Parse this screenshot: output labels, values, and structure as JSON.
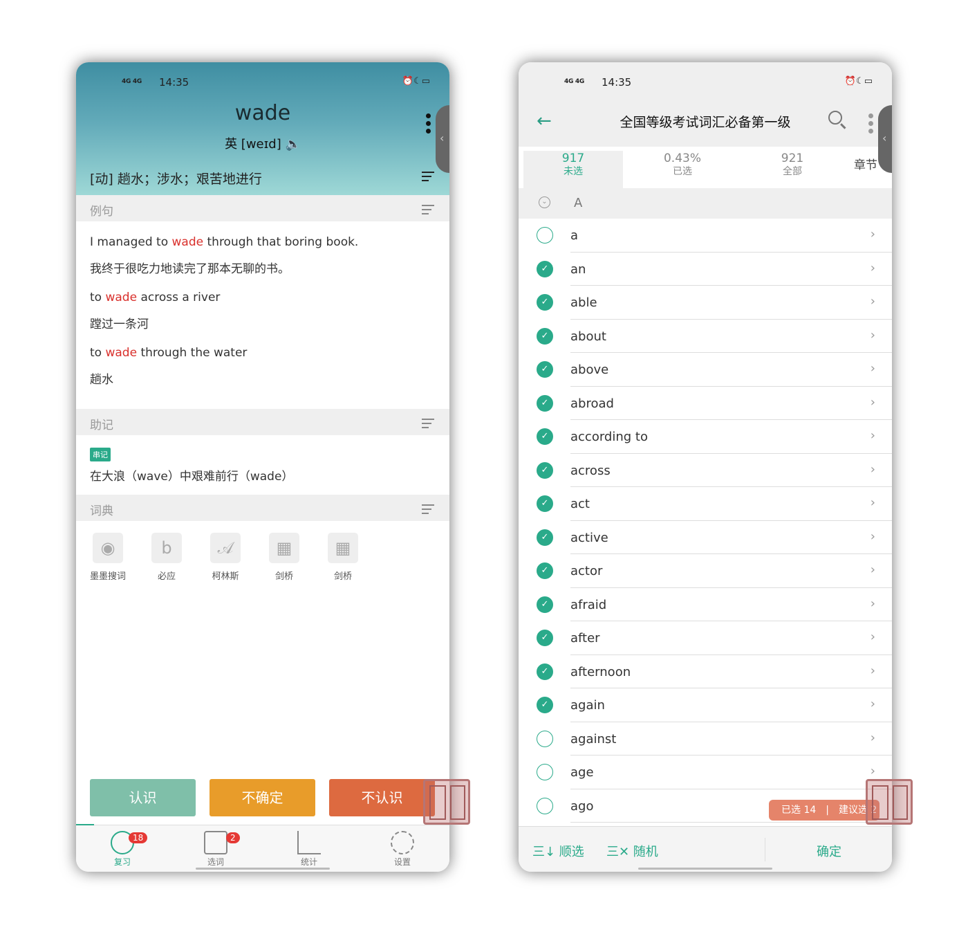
{
  "status": {
    "time": "14:35",
    "network": "4G 4G",
    "icons": "alarm moon battery"
  },
  "left": {
    "word": "wade",
    "phonetic": "英 [weɪd]",
    "speaker_icon": "🔈",
    "definition": "[动] 趟水；涉水；艰苦地进行",
    "sections": {
      "examples": "例句",
      "mnemonic": "助记",
      "dictionary": "词典"
    },
    "examples": [
      {
        "pre": "I managed to ",
        "hl": "wade",
        "post": " through that boring book.",
        "cn": "我终于很吃力地读完了那本无聊的书。"
      },
      {
        "pre": "to ",
        "hl": "wade",
        "post": " across a river",
        "cn": "蹚过一条河"
      },
      {
        "pre": "to ",
        "hl": "wade",
        "post": " through the water",
        "cn": "趟水"
      }
    ],
    "mnemonic_tag": "串记",
    "mnemonic_text": "在大浪（wave）中艰难前行（wade）",
    "dicts": [
      {
        "label": "墨墨搜词",
        "icon": "owl-icon"
      },
      {
        "label": "必应",
        "icon": "bing-icon"
      },
      {
        "label": "柯林斯",
        "icon": "collins-icon"
      },
      {
        "label": "剑桥",
        "icon": "cambridge-cn-icon"
      },
      {
        "label": "剑桥",
        "icon": "cambridge-en-icon"
      }
    ],
    "buttons": {
      "know": "认识",
      "unsure": "不确定",
      "unknown": "不认识"
    },
    "colors": {
      "know": "#7fbfa9",
      "unsure": "#e89c2a",
      "unknown": "#dd6a40",
      "accent": "#2aaa8a"
    },
    "nav": [
      {
        "label": "复习",
        "badge": "18"
      },
      {
        "label": "选词",
        "badge": "2"
      },
      {
        "label": "统计"
      },
      {
        "label": "设置"
      }
    ]
  },
  "right": {
    "title": "全国等级考试词汇必备第一级",
    "stats": [
      {
        "value": "917",
        "label": "未选"
      },
      {
        "value": "0.43%",
        "label": "已选"
      },
      {
        "value": "921",
        "label": "全部"
      }
    ],
    "chapter": "章节",
    "group": "A",
    "words": [
      {
        "w": "a",
        "checked": false
      },
      {
        "w": "an",
        "checked": true
      },
      {
        "w": "able",
        "checked": true
      },
      {
        "w": "about",
        "checked": true
      },
      {
        "w": "above",
        "checked": true
      },
      {
        "w": "abroad",
        "checked": true
      },
      {
        "w": "according to",
        "checked": true
      },
      {
        "w": "across",
        "checked": true
      },
      {
        "w": "act",
        "checked": true
      },
      {
        "w": "active",
        "checked": true
      },
      {
        "w": "actor",
        "checked": true
      },
      {
        "w": "afraid",
        "checked": true
      },
      {
        "w": "after",
        "checked": true
      },
      {
        "w": "afternoon",
        "checked": true
      },
      {
        "w": "again",
        "checked": true
      },
      {
        "w": "against",
        "checked": false
      },
      {
        "w": "age",
        "checked": false
      },
      {
        "w": "ago",
        "checked": false
      }
    ],
    "selected_pill": "已选 14　|　建议选 2",
    "footer": {
      "sequential": "三↓ 顺选",
      "random": "三✕ 随机",
      "confirm": "确定"
    }
  }
}
